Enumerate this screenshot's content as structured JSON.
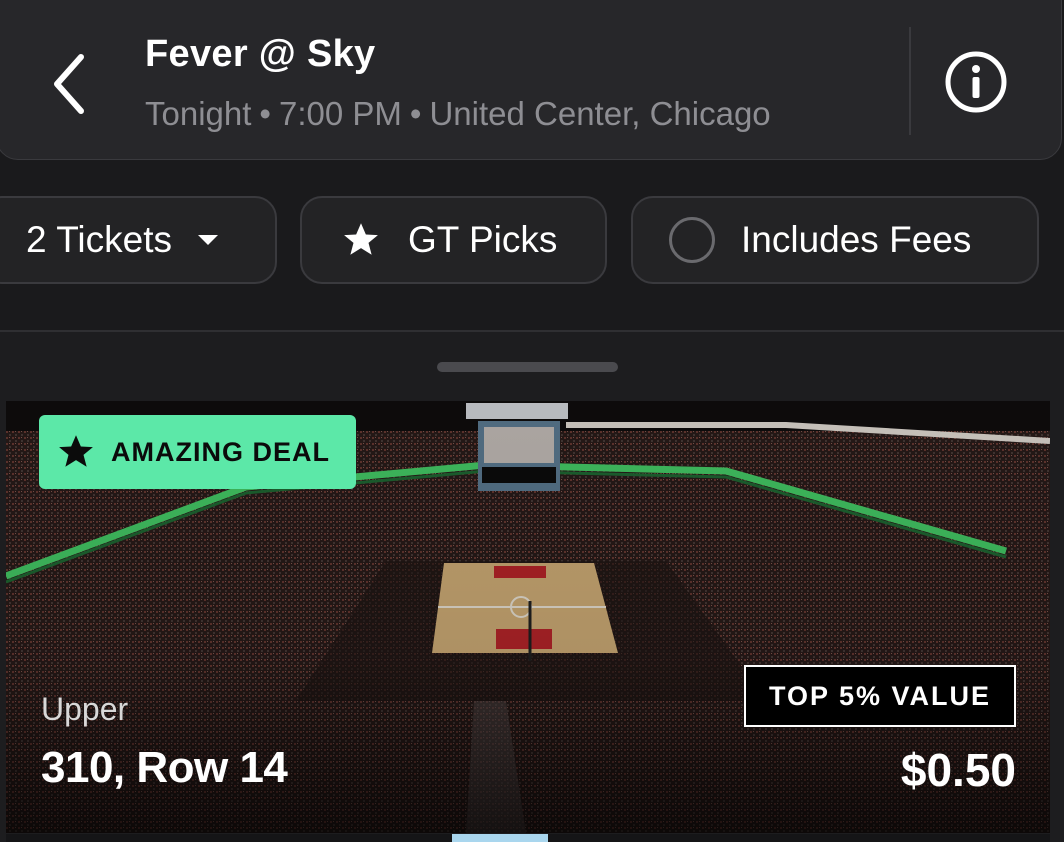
{
  "header": {
    "title": "Fever @ Sky",
    "subtitle": {
      "when": "Tonight",
      "time": "7:00 PM",
      "venue": "United Center, Chicago",
      "separator": "•"
    },
    "back_icon": "chevron-left-icon",
    "info_icon": "info-icon"
  },
  "filters": {
    "tickets_label": "2 Tickets",
    "picks_label": "GT Picks",
    "fees_label": "Includes Fees",
    "fees_checked": false
  },
  "listing": {
    "badge": "AMAZING DEAL",
    "value_badge": "TOP 5% VALUE",
    "level": "Upper",
    "seat": "310, Row 14",
    "price": "$0.50",
    "image": "arena-photo"
  },
  "colors": {
    "background": "#1a1a1c",
    "card": "#27272a",
    "deal_badge": "#5ce8a8",
    "text_muted": "#8e8e93"
  }
}
